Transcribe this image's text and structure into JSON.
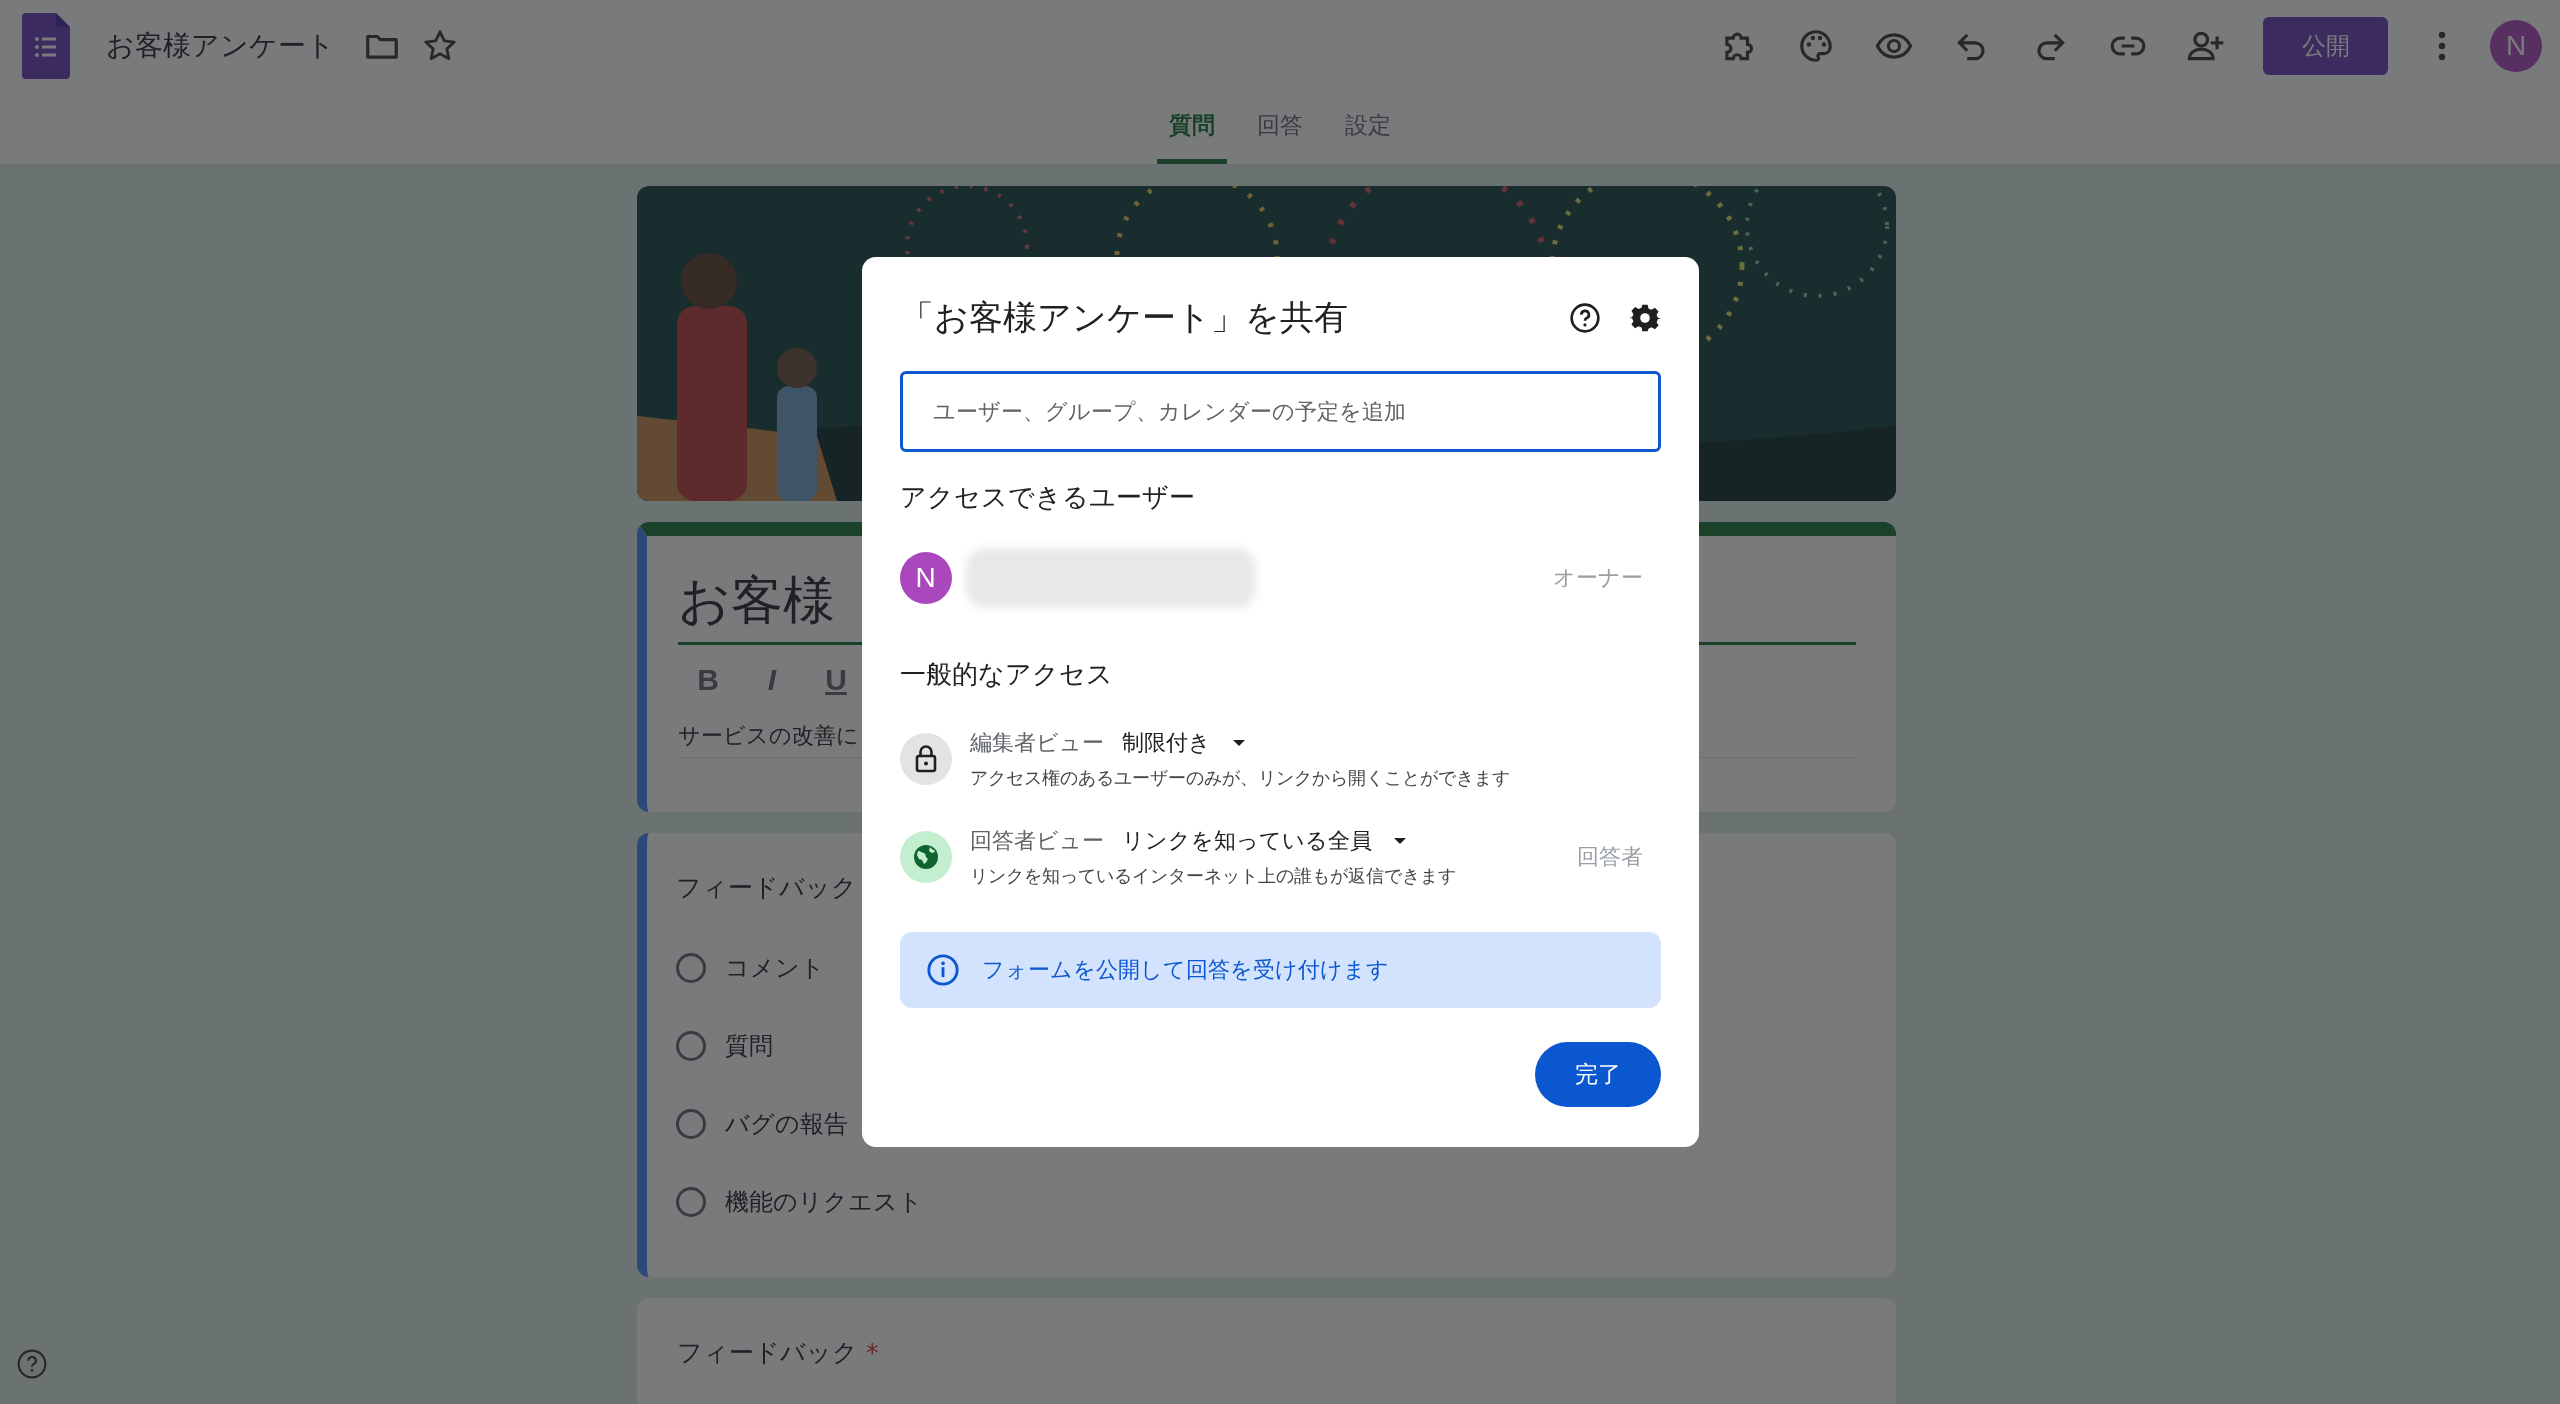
{
  "app": {
    "title": "お客様アンケート",
    "publish_button": "公開",
    "avatar": "N"
  },
  "tabs": [
    {
      "label": "質問",
      "selected": true
    },
    {
      "label": "回答",
      "selected": false
    },
    {
      "label": "設定",
      "selected": false
    }
  ],
  "title_card": {
    "title": "お客様",
    "toolbar": [
      "B",
      "I",
      "U"
    ],
    "description": "サービスの改善に"
  },
  "question_card": {
    "title": "フィードバック",
    "options": [
      {
        "label": "コメント",
        "selected": false
      },
      {
        "label": "質問",
        "selected": false
      },
      {
        "label": "バグの報告",
        "selected": false
      },
      {
        "label": "機能のリクエスト",
        "selected": false
      }
    ]
  },
  "next_card": {
    "title": "フィードバック",
    "required_mark": "*"
  },
  "share_dialog": {
    "title": "「お客様アンケート」を共有",
    "search": {
      "placeholder": "ユーザー、グループ、カレンダーの予定を追加"
    },
    "people_heading": "アクセスできるユーザー",
    "people": [
      {
        "avatar": "N",
        "role": "オーナー"
      }
    ],
    "general_heading": "一般的なアクセス",
    "access": [
      {
        "kind": "restricted",
        "label": "編集者ビュー",
        "value": "制限付き",
        "description": "アクセス権のあるユーザーのみが、リンクから開くことができます"
      },
      {
        "kind": "public",
        "label": "回答者ビュー",
        "value": "リンクを知っている全員",
        "description": "リンクを知っているインターネット上の誰もが返信できます",
        "role": "回答者"
      }
    ],
    "info": "フォームを公開して回答を受け付けます",
    "done_button": "完了"
  }
}
